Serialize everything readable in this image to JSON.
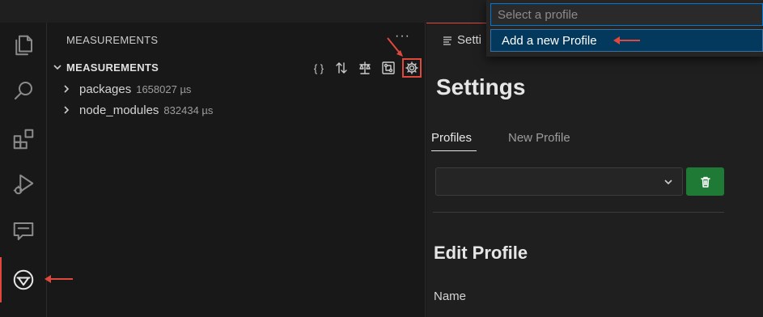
{
  "sidebar": {
    "title": "MEASUREMENTS",
    "more_label": "···",
    "section_label": "MEASUREMENTS",
    "toolbar": {
      "braces_label": "{ }",
      "icons": [
        "sort-icon",
        "scale-icon",
        "circuit-icon",
        "gear-icon"
      ]
    },
    "tree": [
      {
        "name": "packages",
        "time": "1658027 µs"
      },
      {
        "name": "node_modules",
        "time": "832434 µs"
      }
    ]
  },
  "activity_bar": {
    "items": [
      "explorer-icon",
      "search-icon",
      "extensions-icon",
      "run-debug-icon",
      "chat-icon",
      "measurements-icon"
    ],
    "active": "measurements-icon"
  },
  "editor": {
    "tab_label": "Setti",
    "title": "Settings",
    "tabs": [
      {
        "label": "Profiles",
        "active": true
      },
      {
        "label": "New Profile",
        "active": false
      }
    ],
    "select_value": "",
    "section_title": "Edit Profile",
    "field_label": "Name"
  },
  "quick_pick": {
    "placeholder": "Select a profile",
    "items": [
      {
        "label": "Add a new Profile",
        "selected": true
      }
    ]
  },
  "colors": {
    "accent": "#e0483e",
    "focus": "#0078d4",
    "danger_button": "#1e7a34",
    "selection": "#04395e"
  }
}
